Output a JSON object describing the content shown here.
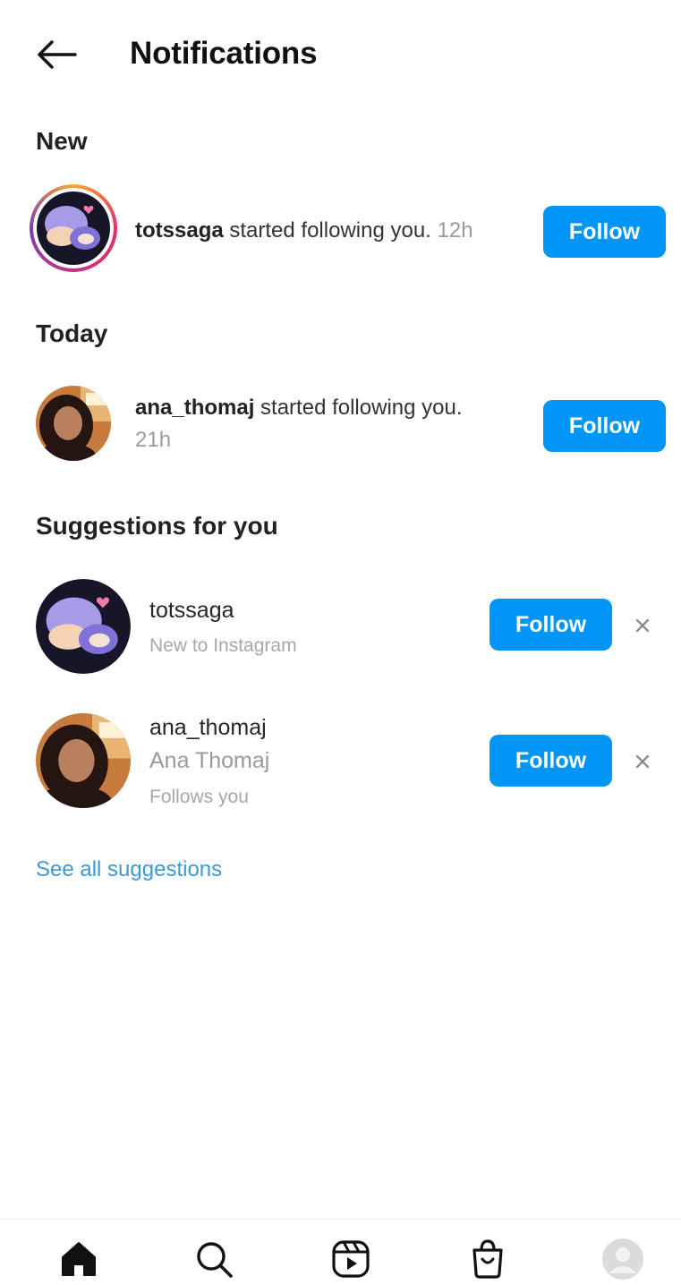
{
  "header": {
    "title": "Notifications",
    "back_icon": "arrow-left-icon"
  },
  "sections": {
    "new": "New",
    "today": "Today",
    "suggestions": "Suggestions for you"
  },
  "notifications": [
    {
      "username": "totssaga",
      "action": " started following you.",
      "time": "12h",
      "button": "Follow",
      "avatar": "sleeping-cartoon-avatar"
    },
    {
      "username": "ana_thomaj",
      "action": " started following you.",
      "time": "21h",
      "button": "Follow",
      "avatar": "person-photo-avatar"
    }
  ],
  "suggestions": [
    {
      "username": "totssaga",
      "subtitle": "New to Instagram",
      "button": "Follow",
      "dismiss_icon": "close-icon"
    },
    {
      "username": "ana_thomaj",
      "fullname": "Ana Thomaj",
      "subtitle": "Follows you",
      "button": "Follow",
      "dismiss_icon": "close-icon"
    }
  ],
  "see_all": "See all suggestions",
  "bottom_nav": [
    "home-icon",
    "search-icon",
    "reels-icon",
    "shop-icon",
    "profile-icon"
  ],
  "colors": {
    "accent": "#0095f6",
    "link": "#3a9ad9",
    "story_ring": "#c13584"
  }
}
